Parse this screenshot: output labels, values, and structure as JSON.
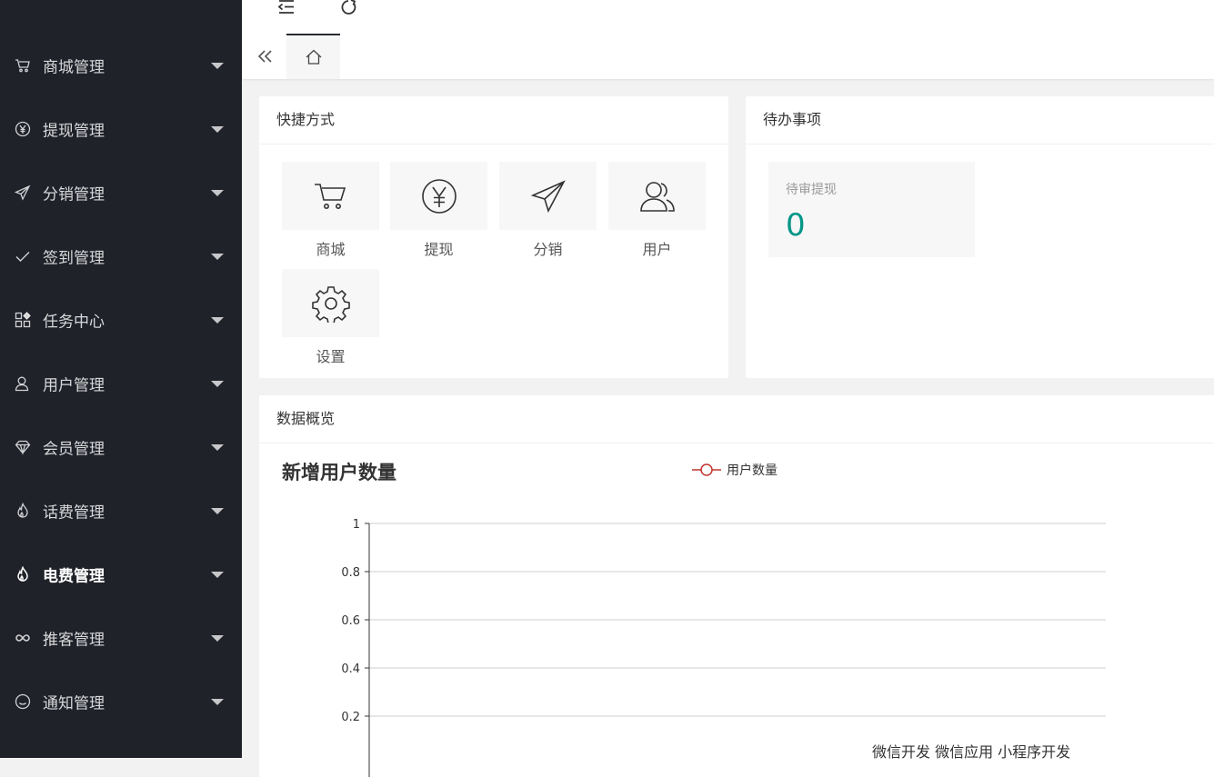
{
  "sidebar": {
    "items": [
      {
        "label": "商城管理",
        "icon": "cart-icon"
      },
      {
        "label": "提现管理",
        "icon": "yen-icon"
      },
      {
        "label": "分销管理",
        "icon": "send-icon"
      },
      {
        "label": "签到管理",
        "icon": "check-icon"
      },
      {
        "label": "任务中心",
        "icon": "apps-icon"
      },
      {
        "label": "用户管理",
        "icon": "user-icon"
      },
      {
        "label": "会员管理",
        "icon": "diamond-icon"
      },
      {
        "label": "话费管理",
        "icon": "fire-icon"
      },
      {
        "label": "电费管理",
        "icon": "fire-icon"
      },
      {
        "label": "推客管理",
        "icon": "infinity-icon"
      },
      {
        "label": "通知管理",
        "icon": "smile-icon"
      }
    ],
    "active_label": "电费管理"
  },
  "shortcuts": {
    "title": "快捷方式",
    "items": [
      {
        "label": "商城",
        "icon": "cart-icon"
      },
      {
        "label": "提现",
        "icon": "yen-icon"
      },
      {
        "label": "分销",
        "icon": "send-icon"
      },
      {
        "label": "用户",
        "icon": "users-icon"
      },
      {
        "label": "设置",
        "icon": "gear-icon"
      }
    ]
  },
  "todo": {
    "title": "待办事项",
    "items": [
      {
        "label": "待审提现",
        "count": "0"
      }
    ]
  },
  "overview": {
    "title": "数据概览"
  },
  "colors": {
    "sidebar_bg": "#20222a",
    "accent": "#009688",
    "series_line": "#c23531"
  },
  "chart_data": {
    "type": "line",
    "title": "新增用户数量",
    "series": [
      {
        "name": "用户数量",
        "values": []
      }
    ],
    "yticks": [
      "1",
      "0.8",
      "0.6",
      "0.4",
      "0.2"
    ],
    "ylim": [
      0,
      1
    ],
    "xlabels_partial": "微信开发 微信应用 小程序开发",
    "grid": true,
    "legend": "top-center"
  }
}
